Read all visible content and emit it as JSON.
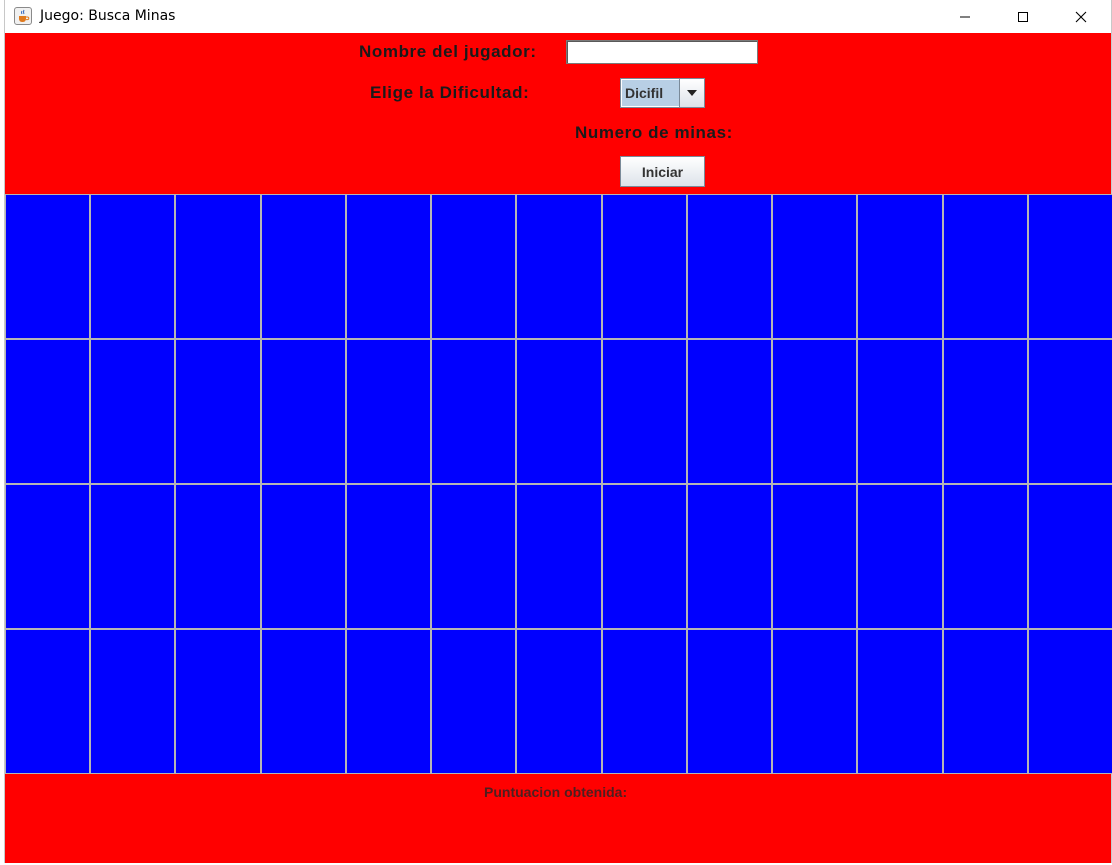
{
  "window": {
    "title": "Juego: Busca Minas",
    "controls": [
      "minimize",
      "maximize",
      "close"
    ]
  },
  "form": {
    "player_name_label": "Nombre del jugador:",
    "player_name_value": "",
    "difficulty_label": "Elige la Dificultad:",
    "difficulty_selected": "Dicifil",
    "mines_label": "Numero de minas:",
    "start_button": "Iniciar"
  },
  "board": {
    "rows": 4,
    "columns": 13,
    "cell_color": "#0000ff"
  },
  "footer": {
    "score_label": "Puntuacion obtenida:"
  },
  "colors": {
    "background": "#ff0000",
    "cell": "#0000ff",
    "combo_highlight": "#b8cfe5"
  },
  "icons": [
    "java-cup-icon",
    "minimize-icon",
    "maximize-icon",
    "close-icon",
    "dropdown-arrow-icon"
  ]
}
